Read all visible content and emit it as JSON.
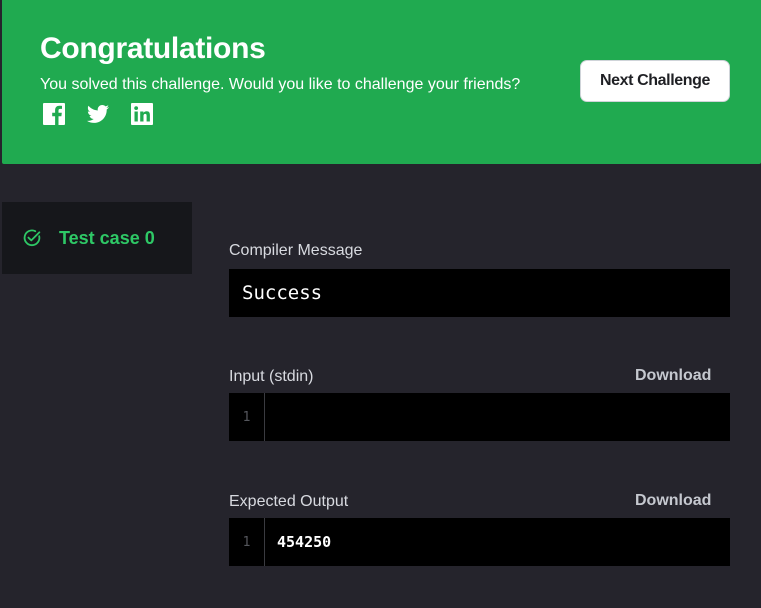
{
  "banner": {
    "title": "Congratulations",
    "subtitle": "You solved this challenge. Would you like to challenge your friends?",
    "social_icons": [
      "facebook-icon",
      "twitter-icon",
      "linkedin-icon"
    ],
    "next_button_label": "Next Challenge",
    "background_color": "#20aa50"
  },
  "testcases": {
    "items": [
      {
        "label": "Test case 0",
        "status": "passed",
        "icon": "check-circle-icon"
      }
    ],
    "status_color": "#2ec866"
  },
  "compiler": {
    "label": "Compiler Message",
    "message": "Success"
  },
  "input": {
    "label": "Input (stdin)",
    "download_label": "Download",
    "line_number": "1",
    "content": ""
  },
  "expected": {
    "label": "Expected Output",
    "download_label": "Download",
    "line_number": "1",
    "content": "454250"
  }
}
